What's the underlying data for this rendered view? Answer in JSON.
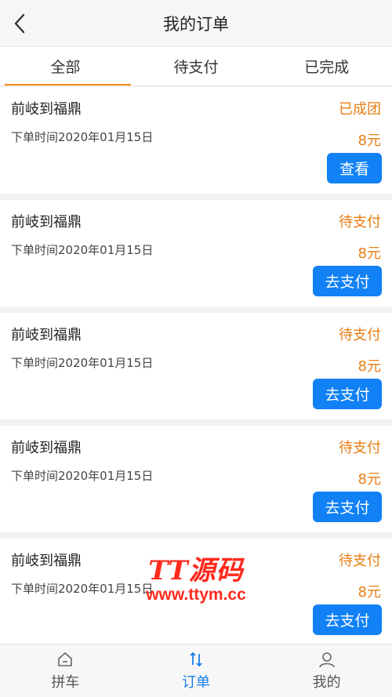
{
  "header": {
    "title": "我的订单",
    "back_icon": "chevron-left-icon"
  },
  "tabs": [
    {
      "label": "全部",
      "active": true
    },
    {
      "label": "待支付",
      "active": false
    },
    {
      "label": "已完成",
      "active": false
    }
  ],
  "orders": [
    {
      "route": "前岐到福鼎",
      "status": "已成团",
      "time": "下单时间2020年01月15日",
      "price": "8元",
      "action": "查看"
    },
    {
      "route": "前岐到福鼎",
      "status": "待支付",
      "time": "下单时间2020年01月15日",
      "price": "8元",
      "action": "去支付"
    },
    {
      "route": "前岐到福鼎",
      "status": "待支付",
      "time": "下单时间2020年01月15日",
      "price": "8元",
      "action": "去支付"
    },
    {
      "route": "前岐到福鼎",
      "status": "待支付",
      "time": "下单时间2020年01月15日",
      "price": "8元",
      "action": "去支付"
    },
    {
      "route": "前岐到福鼎",
      "status": "待支付",
      "time": "下单时间2020年01月15日",
      "price": "8元",
      "action": "去支付"
    }
  ],
  "watermark": {
    "top": "TT源码",
    "bottom": "www.ttym.cc"
  },
  "bottom_nav": [
    {
      "label": "拼车",
      "icon": "home-icon",
      "active": false
    },
    {
      "label": "订单",
      "icon": "sort-arrows-icon",
      "active": true
    },
    {
      "label": "我的",
      "icon": "user-icon",
      "active": false
    }
  ],
  "colors": {
    "accent_orange": "#e87e14",
    "primary_blue": "#1181f5",
    "nav_active": "#1a7fe8"
  }
}
